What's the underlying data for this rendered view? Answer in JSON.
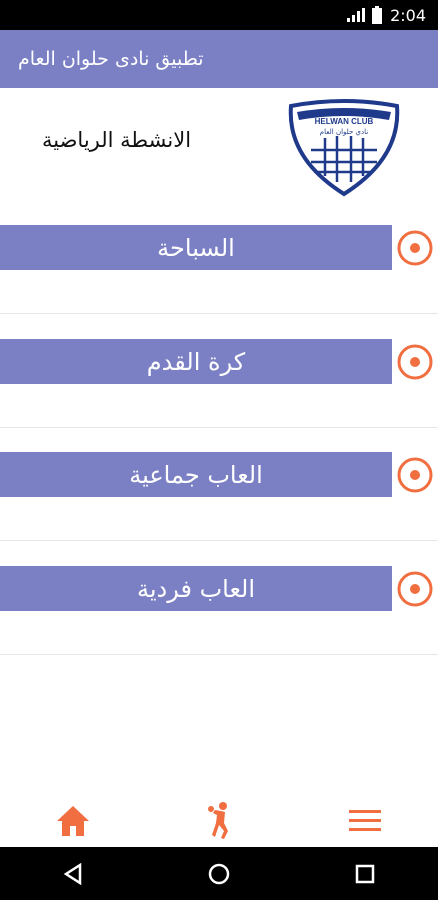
{
  "status_bar": {
    "time": "2:04"
  },
  "app_bar": {
    "title": "تطبيق نادى حلوان العام"
  },
  "header": {
    "heading": "الانشطة الرياضية",
    "logo_text_top": "HELWAN CLUB",
    "logo_text_sub": "نادي حلوان العام"
  },
  "activities": [
    {
      "label": "السباحة"
    },
    {
      "label": "كرة القدم"
    },
    {
      "label": "العاب جماعية"
    },
    {
      "label": "العاب فردية"
    }
  ],
  "colors": {
    "primary": "#7b80c4",
    "accent": "#f06e40"
  },
  "bottom_nav": [
    {
      "icon": "home-icon"
    },
    {
      "icon": "athlete-icon"
    },
    {
      "icon": "menu-icon"
    }
  ]
}
